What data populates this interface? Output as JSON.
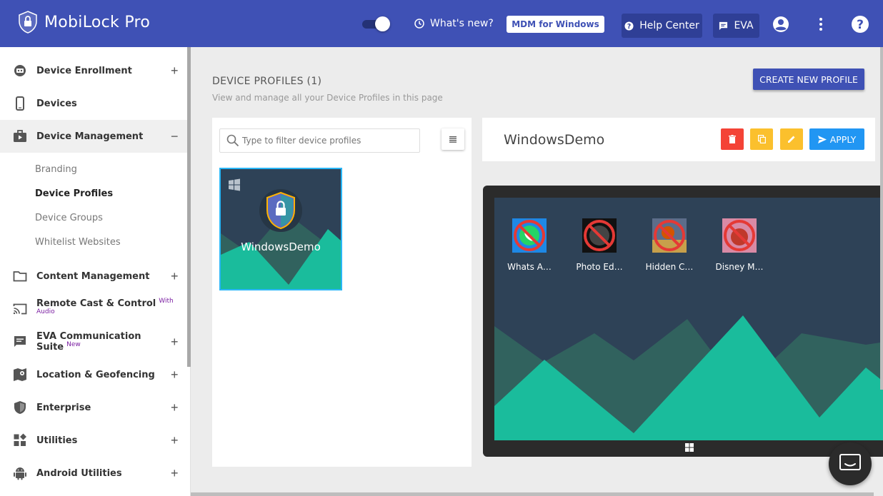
{
  "app": {
    "name": "MobiLock Pro"
  },
  "header": {
    "whats_new": "What's new?",
    "mdm_button": "MDM for Windows",
    "help_center": "Help Center",
    "eva": "EVA"
  },
  "sidebar": {
    "items": [
      {
        "label": "Device Enrollment",
        "icon": "enrollment-icon",
        "expand": "+"
      },
      {
        "label": "Devices",
        "icon": "phone-icon"
      },
      {
        "label": "Device Management",
        "icon": "briefcase-icon",
        "expand": "−"
      },
      {
        "label": "Content Management",
        "icon": "folder-icon",
        "expand": "+"
      },
      {
        "label": "Remote Cast & Control",
        "icon": "cast-icon",
        "badge": "With Audio"
      },
      {
        "label": "EVA Communication Suite",
        "icon": "chat-icon",
        "badge": "New",
        "expand": "+"
      },
      {
        "label": "Location & Geofencing",
        "icon": "map-icon",
        "expand": "+"
      },
      {
        "label": "Enterprise",
        "icon": "shield-icon",
        "expand": "+"
      },
      {
        "label": "Utilities",
        "icon": "widgets-icon",
        "expand": "+"
      },
      {
        "label": "Android Utilities",
        "icon": "android-icon",
        "expand": "+"
      }
    ],
    "sub_items": [
      "Branding",
      "Device Profiles",
      "Device Groups",
      "Whitelist Websites"
    ],
    "selected_sub": "Device Profiles"
  },
  "main": {
    "title": "DEVICE PROFILES (1)",
    "subtitle": "View and manage all your Device Profiles in this page",
    "create_button": "CREATE NEW PROFILE",
    "search_placeholder": "Type to filter device profiles",
    "profile_card_name": "WindowsDemo",
    "detail_title": "WindowsDemo",
    "apply_button": "APPLY",
    "apps": [
      {
        "label": "Whats A…",
        "icon": "whatsapp-icon"
      },
      {
        "label": "Photo Ed…",
        "icon": "photo-editor-icon"
      },
      {
        "label": "Hidden C…",
        "icon": "hidden-city-icon"
      },
      {
        "label": "Disney M…",
        "icon": "disney-icon"
      }
    ]
  },
  "colors": {
    "primary": "#3f51b5",
    "delete": "#f44336",
    "copy": "#fbc02d",
    "edit": "#fbc02d",
    "apply": "#2196f3",
    "mountain": "#1abc9c"
  }
}
